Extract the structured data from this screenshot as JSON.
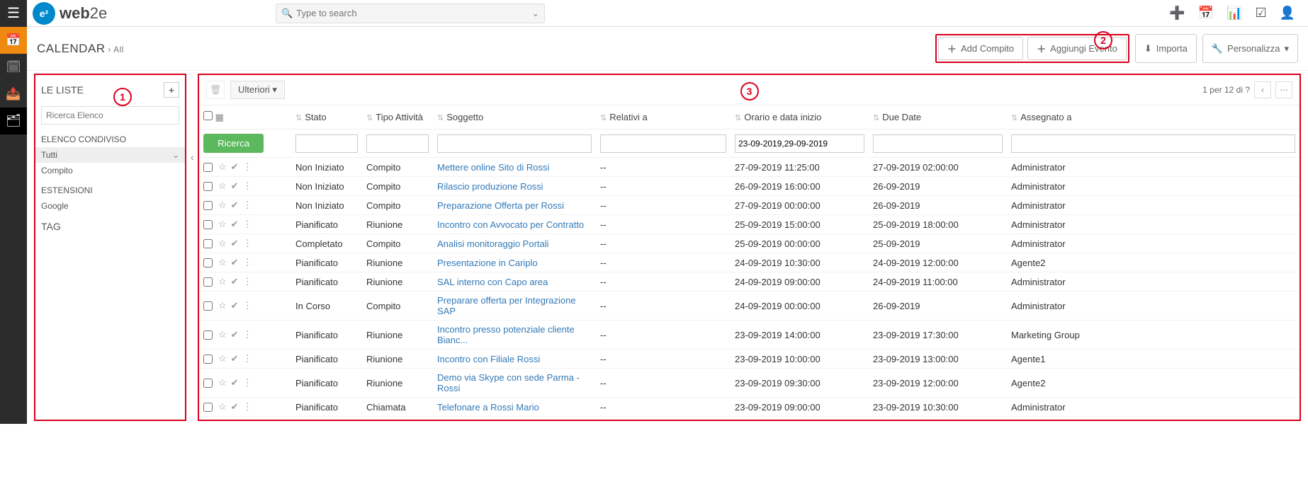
{
  "header": {
    "logo_text_bold": "web",
    "logo_text_light": "2e",
    "logo_badge": "e²",
    "search_placeholder": "Type to search"
  },
  "subheader": {
    "title": "CALENDAR",
    "breadcrumb": "All",
    "btn_add_compito": "Add Compito",
    "btn_add_evento": "Aggiungi Evento",
    "btn_importa": "Importa",
    "btn_personalizza": "Personalizza"
  },
  "sidebar": {
    "title": "LE LISTE",
    "search_placeholder": "Ricerca Elenco",
    "sec_shared": "ELENCO CONDIVISO",
    "item_tutti": "Tutti",
    "item_compito": "Compito",
    "sec_ext": "ESTENSIONI",
    "item_google": "Google",
    "sec_tag": "TAG"
  },
  "content": {
    "ulteriori": "Ulteriori",
    "pager_text": "1 per 12  di ?",
    "search_btn": "Ricerca",
    "date_filter": "23-09-2019,29-09-2019",
    "columns": {
      "stato": "Stato",
      "tipo": "Tipo Attività",
      "soggetto": "Soggetto",
      "relativi": "Relativi a",
      "orario": "Orario e data inizio",
      "due": "Due Date",
      "assegnato": "Assegnato a"
    },
    "rows": [
      {
        "stato": "Non Iniziato",
        "tipo": "Compito",
        "soggetto": "Mettere online Sito di Rossi",
        "rel": "--",
        "orario": "27-09-2019 11:25:00",
        "due": "27-09-2019 02:00:00",
        "ass": "Administrator"
      },
      {
        "stato": "Non Iniziato",
        "tipo": "Compito",
        "soggetto": "Rilascio produzione Rossi",
        "rel": "--",
        "orario": "26-09-2019 16:00:00",
        "due": "26-09-2019",
        "ass": "Administrator"
      },
      {
        "stato": "Non Iniziato",
        "tipo": "Compito",
        "soggetto": "Preparazione Offerta per Rossi",
        "rel": "--",
        "orario": "27-09-2019 00:00:00",
        "due": "26-09-2019",
        "ass": "Administrator"
      },
      {
        "stato": "Pianificato",
        "tipo": "Riunione",
        "soggetto": "Incontro con Avvocato per Contratto",
        "rel": "--",
        "orario": "25-09-2019 15:00:00",
        "due": "25-09-2019 18:00:00",
        "ass": "Administrator"
      },
      {
        "stato": "Completato",
        "tipo": "Compito",
        "soggetto": "Analisi monitoraggio Portali",
        "rel": "--",
        "orario": "25-09-2019 00:00:00",
        "due": "25-09-2019",
        "ass": "Administrator"
      },
      {
        "stato": "Pianificato",
        "tipo": "Riunione",
        "soggetto": "Presentazione in Cariplo",
        "rel": "--",
        "orario": "24-09-2019 10:30:00",
        "due": "24-09-2019 12:00:00",
        "ass": "Agente2"
      },
      {
        "stato": "Pianificato",
        "tipo": "Riunione",
        "soggetto": "SAL interno con Capo area",
        "rel": "--",
        "orario": "24-09-2019 09:00:00",
        "due": "24-09-2019 11:00:00",
        "ass": "Administrator"
      },
      {
        "stato": "In Corso",
        "tipo": "Compito",
        "soggetto": "Preparare offerta per Integrazione SAP",
        "rel": "--",
        "orario": "24-09-2019 00:00:00",
        "due": "26-09-2019",
        "ass": "Administrator"
      },
      {
        "stato": "Pianificato",
        "tipo": "Riunione",
        "soggetto": "Incontro presso potenziale cliente Bianc...",
        "rel": "--",
        "orario": "23-09-2019 14:00:00",
        "due": "23-09-2019 17:30:00",
        "ass": "Marketing Group"
      },
      {
        "stato": "Pianificato",
        "tipo": "Riunione",
        "soggetto": "Incontro con Filiale Rossi",
        "rel": "--",
        "orario": "23-09-2019 10:00:00",
        "due": "23-09-2019 13:00:00",
        "ass": "Agente1"
      },
      {
        "stato": "Pianificato",
        "tipo": "Riunione",
        "soggetto": "Demo via Skype con sede Parma - Rossi",
        "rel": "--",
        "orario": "23-09-2019 09:30:00",
        "due": "23-09-2019 12:00:00",
        "ass": "Agente2"
      },
      {
        "stato": "Pianificato",
        "tipo": "Chiamata",
        "soggetto": "Telefonare a Rossi Mario",
        "rel": "--",
        "orario": "23-09-2019 09:00:00",
        "due": "23-09-2019 10:30:00",
        "ass": "Administrator"
      }
    ]
  },
  "annotations": {
    "a1": "1",
    "a2": "2",
    "a3": "3"
  }
}
